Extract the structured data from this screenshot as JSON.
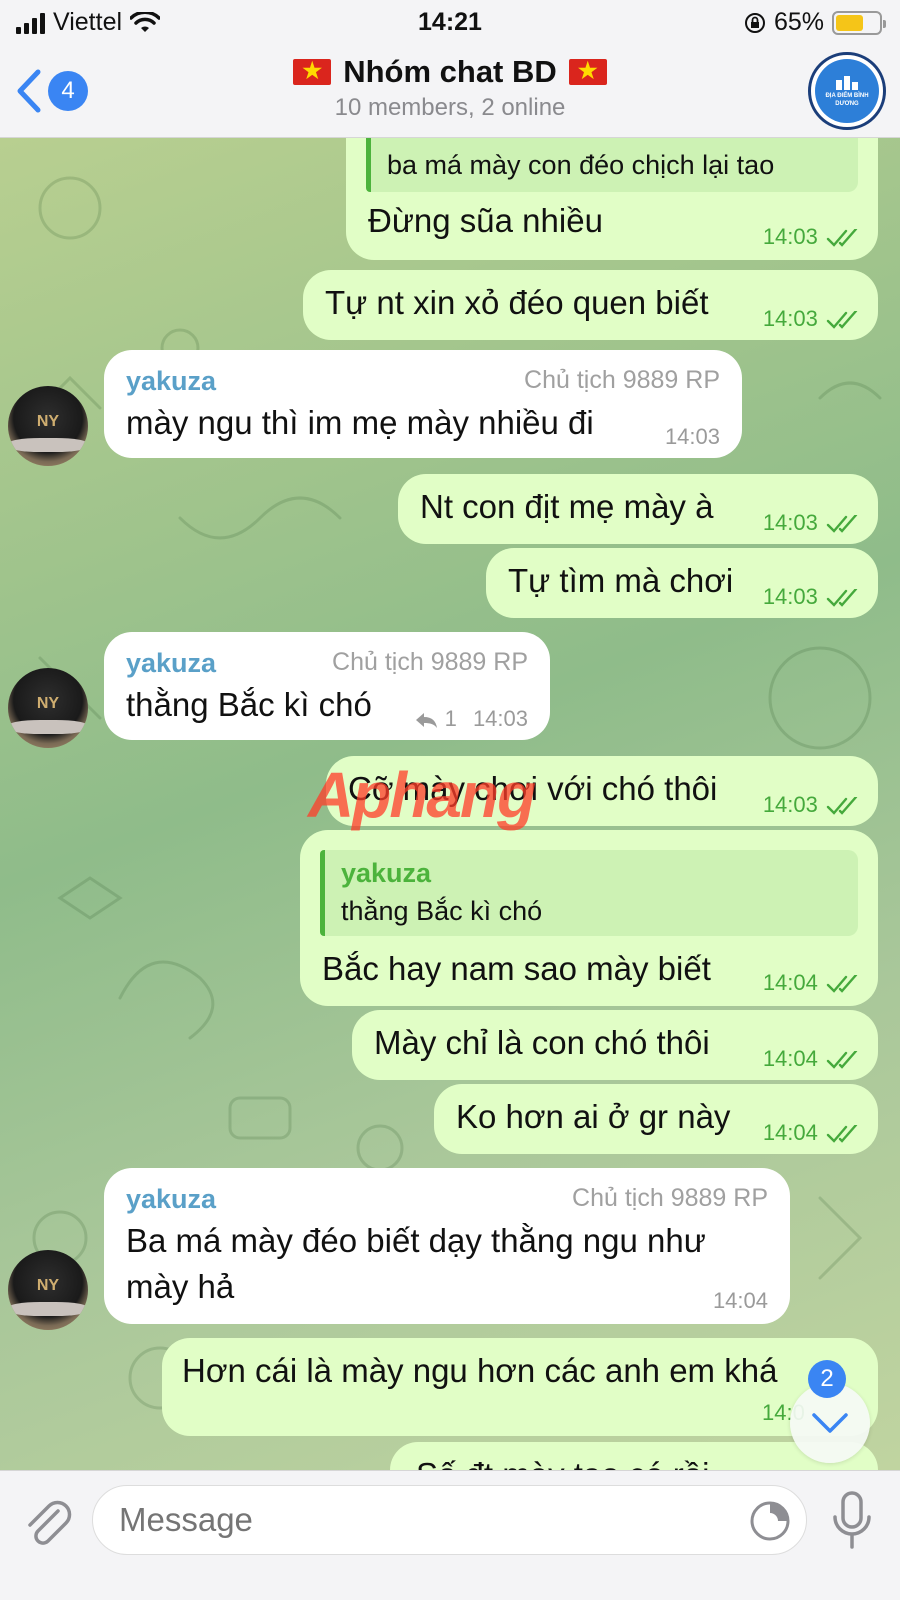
{
  "status_bar": {
    "carrier": "Viettel",
    "time": "14:21",
    "battery": "65%"
  },
  "header": {
    "back_count": "4",
    "title": "Nhóm chat BD",
    "subtitle": "10 members, 2 online",
    "avatar_text": "ĐỊA ĐIỂM BÌNH DƯƠNG"
  },
  "watermark": {
    "part1": "Aphang",
    "part2": ""
  },
  "messages": [
    {
      "type": "out",
      "quote_text": "ba má mày con đéo chịch lại tao",
      "text": "Đừng sũa nhiều",
      "time": "14:03"
    },
    {
      "type": "out",
      "text": "Tự nt xin xỏ đéo quen biết",
      "time": "14:03"
    },
    {
      "type": "in",
      "sender": "yakuza",
      "role": "Chủ tịch 9889 RP",
      "text": "mày ngu thì im mẹ mày nhiều đi",
      "time": "14:03"
    },
    {
      "type": "out",
      "text": "Nt con địt mẹ mày à",
      "time": "14:03"
    },
    {
      "type": "out",
      "text": "Tự tìm mà chơi",
      "time": "14:03"
    },
    {
      "type": "in",
      "sender": "yakuza",
      "role": "Chủ tịch 9889 RP",
      "text": "thằng Bắc kì chó",
      "reply_count": "1",
      "time": "14:03"
    },
    {
      "type": "out",
      "text": "Cỡ mày chơi với chó thôi",
      "time": "14:03"
    },
    {
      "type": "out",
      "quote_name": "yakuza",
      "quote_text": "thằng Bắc kì chó",
      "text": "Bắc hay nam sao mày biết",
      "time": "14:04"
    },
    {
      "type": "out",
      "text": "Mày chỉ là con chó thôi",
      "time": "14:04"
    },
    {
      "type": "out",
      "text": "Ko hơn ai ở gr này",
      "time": "14:04"
    },
    {
      "type": "in",
      "sender": "yakuza",
      "role": "Chủ tịch 9889 RP",
      "text_line1": "Ba má mày đéo biết dạy thằng ngu như",
      "text_line2": "mày hả",
      "time": "14:04"
    },
    {
      "type": "out",
      "text": "Hơn cái là mày ngu hơn các anh em khá",
      "time": "14:0"
    },
    {
      "type": "out",
      "text": "Số đt mày tao có rồi"
    }
  ],
  "scroll_badge": "2",
  "input": {
    "placeholder": "Message"
  },
  "colors": {
    "accent": "#3a85f3",
    "outgoing": "#e1fec6",
    "incoming": "#ffffff",
    "time_green": "#45a93c"
  }
}
